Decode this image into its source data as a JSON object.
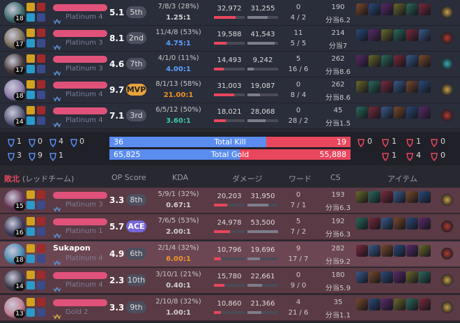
{
  "blue_team": [
    {
      "level": "18",
      "rank": "Platinum 4",
      "score": "5.1",
      "badge": "5th",
      "kda": "7/8/3 (28%)",
      "ratio": "1.25:1",
      "ratio_color": "#d0d0d0",
      "dealt": "32,972",
      "taken": "31,255",
      "dealt_pct": 0.7,
      "taken_pct": 0.66,
      "ward1": "0",
      "ward2": "4 / 2",
      "cs1": "190",
      "cs2": "分当6.2",
      "champ_color": "#3a6a6a",
      "trinket": "#c9a24a"
    },
    {
      "level": "17",
      "rank": "Platinum 3",
      "score": "8.1",
      "badge": "2nd",
      "kda": "11/4/8 (53%)",
      "ratio": "4.75:1",
      "ratio_color": "#5aa0ff",
      "dealt": "19,588",
      "taken": "41,543",
      "dealt_pct": 0.42,
      "taken_pct": 0.88,
      "ward1": "11",
      "ward2": "5 / 5",
      "cs1": "214",
      "cs2": "分当7",
      "champ_color": "#7a6a5a",
      "trinket": "#b03a2e"
    },
    {
      "level": "17",
      "rank": "Platinum 3",
      "score": "4.6",
      "badge": "7th",
      "kda": "4/1/0 (11%)",
      "ratio": "4.00:1",
      "ratio_color": "#5aa0ff",
      "dealt": "14,493",
      "taken": "9,242",
      "dealt_pct": 0.31,
      "taken_pct": 0.2,
      "ward1": "5",
      "ward2": "16 / 6",
      "cs1": "262",
      "cs2": "分当8.6",
      "champ_color": "#4a3a3a",
      "trinket": "#3aa9b0"
    },
    {
      "level": "18",
      "rank": "Platinum 4",
      "score": "9.7",
      "badge": "MVP",
      "kda": "8/1/13 (58%)",
      "ratio": "21.00:1",
      "ratio_color": "#f0942a",
      "dealt": "31,003",
      "taken": "19,087",
      "dealt_pct": 0.66,
      "taken_pct": 0.41,
      "ward1": "0",
      "ward2": "8 / 4",
      "cs1": "262",
      "cs2": "分当8.6",
      "champ_color": "#8a7aa8",
      "trinket": "#c9a24a"
    },
    {
      "level": "14",
      "rank": "Platinum 4",
      "score": "7.1",
      "badge": "3rd",
      "kda": "6/5/12 (50%)",
      "ratio": "3.60:1",
      "ratio_color": "#3ec8a0",
      "dealt": "18,021",
      "taken": "28,068",
      "dealt_pct": 0.38,
      "taken_pct": 0.6,
      "ward1": "0",
      "ward2": "28 / 2",
      "cs1": "45",
      "cs2": "分当1.5",
      "champ_color": "#5a5a7a",
      "trinket": "#b03a2e"
    }
  ],
  "summary": {
    "blue_kill": "36",
    "red_kill": "19",
    "kill_label": "Total Kill",
    "kill_pct": 0.65,
    "blue_gold": "65,825",
    "red_gold": "55,888",
    "gold_label": "Total Gold",
    "gold_pct": 0.54,
    "blue_obj": [
      "1",
      "0",
      "4",
      "0",
      "3",
      "9",
      "1"
    ],
    "red_obj": [
      "0",
      "1",
      "1",
      "0",
      "1",
      "4",
      "0"
    ]
  },
  "red_header": {
    "result": "敗北",
    "team": "(レッドチーム)",
    "op": "OP Score",
    "kda": "KDA",
    "damage": "ダメージ",
    "ward": "ワード",
    "cs": "CS",
    "items": "アイテム"
  },
  "red_team": [
    {
      "name": "",
      "level": "15",
      "rank": "Platinum 3",
      "score": "3.3",
      "badge": "8th",
      "kda": "5/9/1 (32%)",
      "ratio": "0.67:1",
      "ratio_color": "#d0d0d0",
      "dealt": "20,203",
      "taken": "31,950",
      "dealt_pct": 0.43,
      "taken_pct": 0.68,
      "ward1": "0",
      "ward2": "7 / 1",
      "cs1": "193",
      "cs2": "分当6.3",
      "champ_color": "#6a3a5a",
      "trinket": "#c9a24a"
    },
    {
      "name": "",
      "level": "16",
      "rank": "Platinum 1",
      "score": "5.7",
      "badge": "ACE",
      "kda": "7/6/5 (53%)",
      "ratio": "2.00:1",
      "ratio_color": "#d0d0d0",
      "dealt": "24,978",
      "taken": "53,500",
      "dealt_pct": 0.53,
      "taken_pct": 1.0,
      "ward1": "5",
      "ward2": "7 / 2",
      "cs1": "192",
      "cs2": "分当6.3",
      "champ_color": "#3a3a5a",
      "trinket": "#b03a2e"
    },
    {
      "name": "Sukapon",
      "level": "18",
      "rank": "Platinum 4",
      "score": "4.9",
      "badge": "6th",
      "kda": "2/1/4 (32%)",
      "ratio": "6.00:1",
      "ratio_color": "#f0942a",
      "dealt": "10,796",
      "taken": "19,696",
      "dealt_pct": 0.23,
      "taken_pct": 0.42,
      "ward1": "9",
      "ward2": "17 / 7",
      "cs1": "282",
      "cs2": "分当9.2",
      "champ_color": "#4a8ab0",
      "trinket": "#b03a2e"
    },
    {
      "name": "",
      "level": "14",
      "rank": "Platinum 4",
      "score": "2.3",
      "badge": "10th",
      "kda": "3/10/1 (21%)",
      "ratio": "0.40:1",
      "ratio_color": "#d0d0d0",
      "dealt": "15,780",
      "taken": "22,661",
      "dealt_pct": 0.34,
      "taken_pct": 0.48,
      "ward1": "0",
      "ward2": "9 / 0",
      "cs1": "180",
      "cs2": "分当5.9",
      "champ_color": "#3a3a4a",
      "trinket": "#c9a24a"
    },
    {
      "name": "",
      "level": "13",
      "rank": "Gold 2",
      "score": "3.3",
      "badge": "9th",
      "kda": "2/10/8 (32%)",
      "ratio": "1.00:1",
      "ratio_color": "#d0d0d0",
      "dealt": "10,860",
      "taken": "21,366",
      "dealt_pct": 0.23,
      "taken_pct": 0.45,
      "ward1": "4",
      "ward2": "21 / 6",
      "cs1": "35",
      "cs2": "分当1.1",
      "champ_color": "#c08090",
      "trinket": "#c9a24a"
    }
  ],
  "colors": {
    "blue": "#5b8df0",
    "red": "#e8475d",
    "dealt": "#e8475d",
    "taken": "#7c7e8c"
  }
}
